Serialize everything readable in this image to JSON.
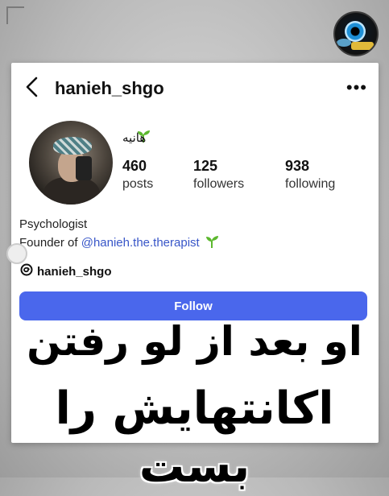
{
  "profile": {
    "username": "hanieh_shgo",
    "display_name": "هانیه",
    "stats": [
      {
        "value": "460",
        "label": "posts"
      },
      {
        "value": "125",
        "label": "followers"
      },
      {
        "value": "938",
        "label": "following"
      }
    ],
    "bio_line1": "Psychologist",
    "bio_line2_prefix": "Founder of ",
    "bio_link": "@hanieh.the.therapist",
    "threads_handle": "hanieh_shgo",
    "follow_label": "Follow"
  },
  "overlay": {
    "line1": "او بعد از لو رفتن",
    "line2": "اکانتهایش را بست"
  },
  "colors": {
    "follow_button": "#4a67ec",
    "link": "#3856c8",
    "sprout": "#5cb82e"
  },
  "icons": [
    "back-arrow-icon",
    "more-options-icon",
    "sprout-icon",
    "threads-icon",
    "channel-logo-icon"
  ]
}
